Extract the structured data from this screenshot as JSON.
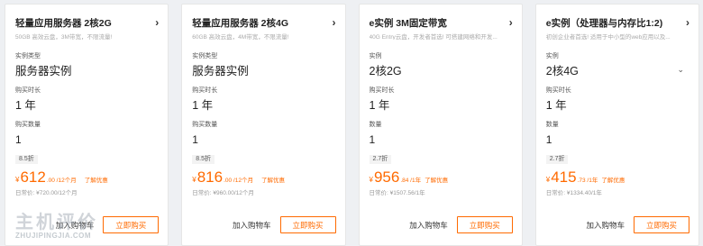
{
  "cards": [
    {
      "title": "轻量应用服务器 2核2G",
      "desc": "50GB 高效云盘，3M带宽，不限流量!",
      "field1_label": "实例类型",
      "field1_value": "服务器实例",
      "field2_label": "购买时长",
      "field2_value": "1 年",
      "field3_label": "购买数量",
      "field3_value": "1",
      "discount": "8.5折",
      "currency": "¥",
      "price": "612",
      "price_unit": ".00 /12个月",
      "promo": "了解优惠",
      "original": "日常价: ¥720.00/12个月",
      "cart_label": "加入购物车",
      "buy_label": "立即购买"
    },
    {
      "title": "轻量应用服务器 2核4G",
      "desc": "60GB 高效云盘，4M带宽，不限流量!",
      "field1_label": "实例类型",
      "field1_value": "服务器实例",
      "field2_label": "购买时长",
      "field2_value": "1 年",
      "field3_label": "购买数量",
      "field3_value": "1",
      "discount": "8.5折",
      "currency": "¥",
      "price": "816",
      "price_unit": ".00 /12个月",
      "promo": "了解优惠",
      "original": "日常价: ¥960.00/12个月",
      "cart_label": "加入购物车",
      "buy_label": "立即购买"
    },
    {
      "title": "e实例 3M固定带宽",
      "desc": "40G Entry云盘，开发者首选! 可搭建网络和开发...",
      "field1_label": "实例",
      "field1_value": "2核2G",
      "field2_label": "购买时长",
      "field2_value": "1 年",
      "field3_label": "数量",
      "field3_value": "1",
      "discount": "2.7折",
      "currency": "¥",
      "price": "956",
      "price_unit": ".84 /1年",
      "promo": "了解优惠",
      "original": "日常价: ¥1507.56/1年",
      "cart_label": "加入购物车",
      "buy_label": "立即购买"
    },
    {
      "title": "e实例（处理器与内存比1:2)",
      "desc": "初创企业者首选! 适用于中小型的web应用以及...",
      "field1_label": "实例",
      "field1_value": "2核4G",
      "field2_label": "购买时长",
      "field2_value": "1 年",
      "field3_label": "数量",
      "field3_value": "1",
      "discount": "2.7折",
      "currency": "¥",
      "price": "415",
      "price_unit": ".73 /1年",
      "promo": "了解优惠",
      "original": "日常价: ¥1334.40/1年",
      "cart_label": "加入购物车",
      "buy_label": "立即购买"
    }
  ],
  "icons": {
    "title_chevron": "chevron-right-icon",
    "select_chevron": "chevron-down-icon"
  },
  "watermark": {
    "cn": "主机评价",
    "en": "ZHUJIPINGJIA.COM"
  },
  "colors": {
    "accent": "#ff6a00",
    "background": "#eef0f3",
    "card": "#ffffff"
  }
}
